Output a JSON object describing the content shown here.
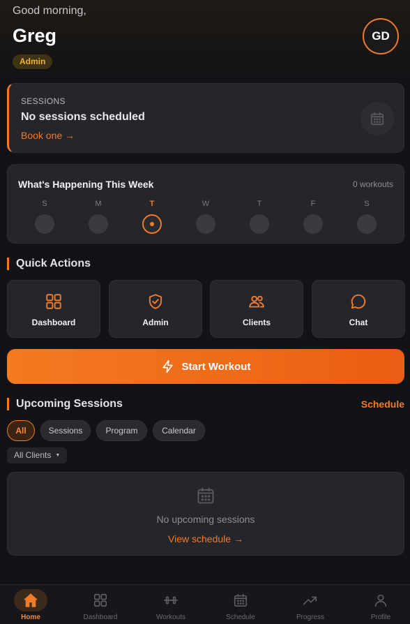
{
  "header": {
    "greeting": "Good morning,",
    "user_name": "Greg",
    "role_badge": "Admin",
    "avatar_initials": "GD"
  },
  "sessions_card": {
    "label": "SESSIONS",
    "title": "No sessions scheduled",
    "link": "Book one →",
    "icon": "calendar-icon"
  },
  "week": {
    "title": "What's Happening This Week",
    "count": "0 workouts",
    "days": [
      "S",
      "M",
      "T",
      "W",
      "T",
      "F",
      "S"
    ],
    "today_index": 2
  },
  "quick_actions": {
    "title": "Quick Actions",
    "items": [
      {
        "label": "Dashboard",
        "icon": "grid-icon"
      },
      {
        "label": "Admin",
        "icon": "shield-check-icon"
      },
      {
        "label": "Clients",
        "icon": "users-icon"
      },
      {
        "label": "Chat",
        "icon": "chat-bubble-icon"
      }
    ]
  },
  "start_workout": {
    "label": "Start Workout",
    "icon": "lightning-icon"
  },
  "upcoming": {
    "title": "Upcoming Sessions",
    "schedule_link": "Schedule",
    "tabs": [
      "All",
      "Sessions",
      "Program",
      "Calendar"
    ],
    "active_tab": "All",
    "client_filter": "All Clients",
    "empty_message": "No upcoming sessions",
    "empty_link": "View schedule →"
  },
  "bottom_nav": {
    "items": [
      {
        "label": "Home",
        "icon": "home-icon"
      },
      {
        "label": "Dashboard",
        "icon": "grid-icon"
      },
      {
        "label": "Workouts",
        "icon": "dumbbell-icon"
      },
      {
        "label": "Schedule",
        "icon": "calendar-icon"
      },
      {
        "label": "Progress",
        "icon": "trend-up-icon"
      },
      {
        "label": "Profile",
        "icon": "user-icon"
      }
    ],
    "active": "Home"
  },
  "colors": {
    "accent": "#f07b2a",
    "background": "#121316",
    "card": "#25262b",
    "badge_text": "#f0b526"
  }
}
